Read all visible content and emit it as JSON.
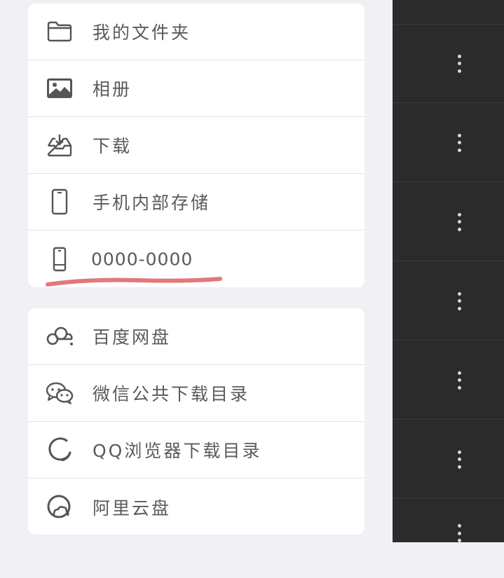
{
  "locations_group_1": [
    {
      "label": "我的文件夹",
      "icon": "folder-icon"
    },
    {
      "label": "相册",
      "icon": "image-icon"
    },
    {
      "label": "下载",
      "icon": "download-tray-icon"
    },
    {
      "label": "手机内部存储",
      "icon": "phone-icon"
    },
    {
      "label": "0000-0000",
      "icon": "phone-storage-icon"
    }
  ],
  "locations_group_2": [
    {
      "label": "百度网盘",
      "icon": "baidu-cloud-icon"
    },
    {
      "label": "微信公共下载目录",
      "icon": "wechat-icon"
    },
    {
      "label": "QQ浏览器下载目录",
      "icon": "qq-browser-icon"
    },
    {
      "label": "阿里云盘",
      "icon": "aliyun-drive-icon"
    }
  ],
  "colors": {
    "background": "#f1f0f5",
    "card": "#ffffff",
    "text": "#5a5a5a",
    "icon": "#555555",
    "right_panel": "#2b2b2b",
    "annotation_underline": "#e06a6a"
  }
}
